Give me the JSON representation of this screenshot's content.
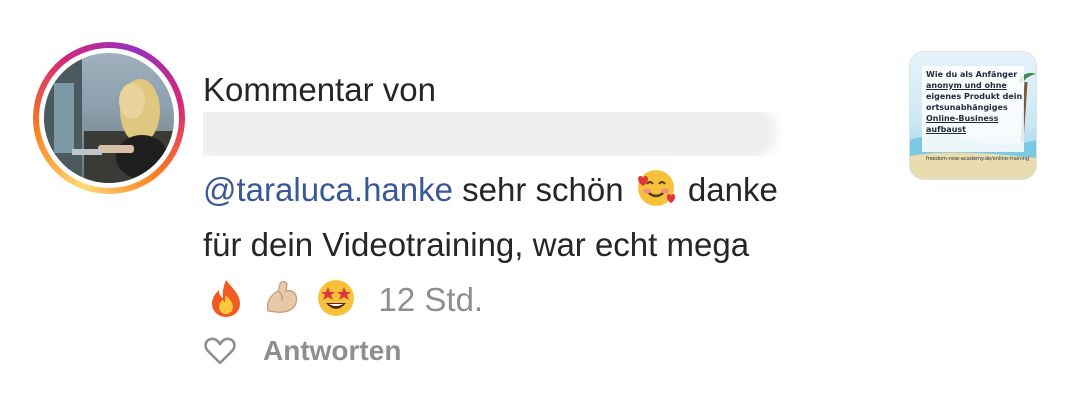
{
  "comment": {
    "header": "Kommentar von",
    "mention": "@taraluca.hanke",
    "text_before_emoji": " sehr schön ",
    "text_after_emoji": " danke",
    "line2": "für dein Videotraining, war echt mega",
    "emojis": [
      "smiling-face-with-hearts",
      "fire",
      "flexed-biceps",
      "star-struck"
    ],
    "timestamp": "12 Std."
  },
  "actions": {
    "reply_label": "Antworten"
  },
  "post_thumbnail": {
    "lines": [
      "Wie du als Anfänger",
      "anonym und ohne",
      "eigenes Produkt dein",
      "ortsunabhängiges",
      "Online-Business",
      "aufbaust"
    ],
    "footer": "freedom-now-academy.de/online-training"
  },
  "colors": {
    "mention": "#385898",
    "muted": "#8e8e8e",
    "text": "#262626"
  }
}
